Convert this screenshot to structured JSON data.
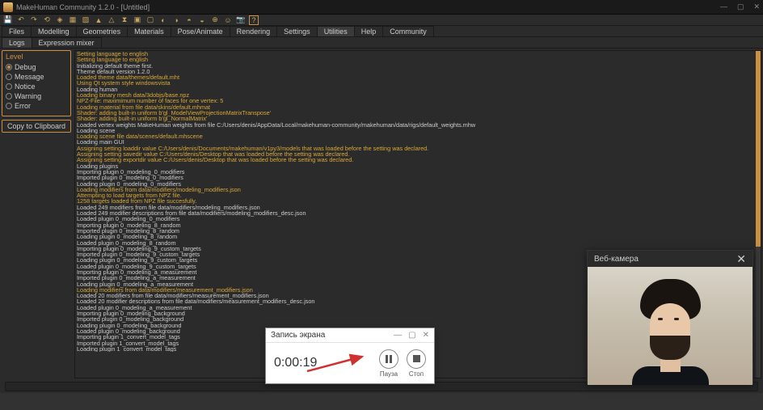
{
  "window": {
    "title": "MakeHuman Community 1.2.0 - [Untitled]"
  },
  "tabs": [
    "Files",
    "Modelling",
    "Geometries",
    "Materials",
    "Pose/Animate",
    "Rendering",
    "Settings",
    "Utilities",
    "Help",
    "Community"
  ],
  "active_tab": "Utilities",
  "subtabs": [
    "Logs",
    "Expression mixer"
  ],
  "active_subtab": "Logs",
  "level": {
    "title": "Level",
    "options": [
      "Debug",
      "Message",
      "Notice",
      "Warning",
      "Error"
    ],
    "selected": "Debug"
  },
  "copy_btn": "Copy to Clipboard",
  "recorder": {
    "title": "Запись экрана",
    "time": "0:00:19",
    "pause": "Пауза",
    "stop": "Стоп"
  },
  "webcam": {
    "title": "Веб-камера"
  },
  "log": [
    {
      "t": "Setting language to english",
      "y": 1
    },
    {
      "t": "Setting language to english",
      "y": 1
    },
    {
      "t": "Initializing default theme first.",
      "y": 0
    },
    {
      "t": "Theme default version 1.2.0",
      "y": 0
    },
    {
      "t": "Loaded theme data/themes/default.mht",
      "y": 1
    },
    {
      "t": "Using Qt system style windowsvista",
      "y": 1
    },
    {
      "t": "Loading human",
      "y": 0
    },
    {
      "t": "Loading binary mesh data/3dobjs/base.npz",
      "y": 1
    },
    {
      "t": "NPZ-File: maximimum number of faces for one vertex: 5",
      "y": 1
    },
    {
      "t": "Loading material from file data/skins/default.mhmat",
      "y": 1
    },
    {
      "t": "Shader: adding built-in uniform b'gl_ModelViewProjectionMatrixTranspose'",
      "y": 1
    },
    {
      "t": "Shader: adding built-in uniform b'gl_NormalMatrix'",
      "y": 1
    },
    {
      "t": "Loaded vertex weights MakeHuman weights from file C:/Users/denis/AppData/Local/makehuman-community/makehuman/data/rigs/default_weights.mhw",
      "y": 0
    },
    {
      "t": "Loading scene",
      "y": 0
    },
    {
      "t": "Loading scene file data/scenes/default.mhscene",
      "y": 1
    },
    {
      "t": "Loading main GUI",
      "y": 0
    },
    {
      "t": "Assigning setting loaddir value C:/Users/denis/Documents/makehuman/v1py3/models that was loaded before the setting was declared.",
      "y": 1
    },
    {
      "t": "Assigning setting savedir value C:/Users/denis/Desktop that was loaded before the setting was declared.",
      "y": 1
    },
    {
      "t": "Assigning setting exportdir value C:/Users/denis/Desktop that was loaded before the setting was declared.",
      "y": 1
    },
    {
      "t": "Loading plugins",
      "y": 0
    },
    {
      "t": "Importing plugin 0_modeling_0_modifiers",
      "y": 0
    },
    {
      "t": "Imported plugin 0_modeling_0_modifiers",
      "y": 0
    },
    {
      "t": "Loading plugin 0_modeling_0_modifiers",
      "y": 0
    },
    {
      "t": "Loading modifiers from data/modifiers/modeling_modifiers.json",
      "y": 1
    },
    {
      "t": "Attempting to load targets from NPZ file.",
      "y": 1
    },
    {
      "t": "1258 targets loaded from NPZ file succesfully.",
      "y": 1
    },
    {
      "t": "Loaded 249 modifiers from file data/modifiers/modeling_modifiers.json",
      "y": 0
    },
    {
      "t": "Loaded 249 modifier descriptions from file data/modifiers/modeling_modifiers_desc.json",
      "y": 0
    },
    {
      "t": "Loaded plugin 0_modeling_0_modifiers",
      "y": 0
    },
    {
      "t": "Importing plugin 0_modeling_8_random",
      "y": 0
    },
    {
      "t": "Imported plugin 0_modeling_8_random",
      "y": 0
    },
    {
      "t": "Loading plugin 0_modeling_8_random",
      "y": 0
    },
    {
      "t": "Loaded plugin 0_modeling_8_random",
      "y": 0
    },
    {
      "t": "Importing plugin 0_modeling_9_custom_targets",
      "y": 0
    },
    {
      "t": "Imported plugin 0_modeling_9_custom_targets",
      "y": 0
    },
    {
      "t": "Loading plugin 0_modeling_9_custom_targets",
      "y": 0
    },
    {
      "t": "Loaded plugin 0_modeling_9_custom_targets",
      "y": 0
    },
    {
      "t": "Importing plugin 0_modeling_a_measurement",
      "y": 0
    },
    {
      "t": "Imported plugin 0_modeling_a_measurement",
      "y": 0
    },
    {
      "t": "Loading plugin 0_modeling_a_measurement",
      "y": 0
    },
    {
      "t": "Loading modifiers from data/modifiers/measurement_modifiers.json",
      "y": 1
    },
    {
      "t": "Loaded 20 modifiers from file data/modifiers/measurement_modifiers.json",
      "y": 0
    },
    {
      "t": "Loaded 20 modifier descriptions from file data/modifiers/measurement_modifiers_desc.json",
      "y": 0
    },
    {
      "t": "Loaded plugin 0_modeling_a_measurement",
      "y": 0
    },
    {
      "t": "Importing plugin 0_modeling_background",
      "y": 0
    },
    {
      "t": "Imported plugin 0_modeling_background",
      "y": 0
    },
    {
      "t": "Loading plugin 0_modeling_background",
      "y": 0
    },
    {
      "t": "Loaded plugin 0_modeling_background",
      "y": 0
    },
    {
      "t": "Importing plugin 1_convert_model_tags",
      "y": 0
    },
    {
      "t": "Imported plugin 1_convert_model_tags",
      "y": 0
    },
    {
      "t": "Loading plugin 1_convert_model_tags",
      "y": 0
    }
  ]
}
